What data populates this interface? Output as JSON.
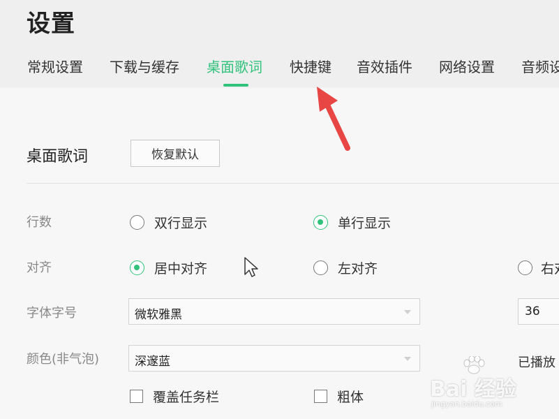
{
  "header": {
    "title": "设置",
    "tabs": [
      {
        "label": "常规设置",
        "active": false
      },
      {
        "label": "下载与缓存",
        "active": false
      },
      {
        "label": "桌面歌词",
        "active": true
      },
      {
        "label": "快捷键",
        "active": false
      },
      {
        "label": "音效插件",
        "active": false
      },
      {
        "label": "网络设置",
        "active": false
      },
      {
        "label": "音频设",
        "active": false
      }
    ]
  },
  "section": {
    "title": "桌面歌词",
    "restore_label": "恢复默认"
  },
  "rows": {
    "lines": {
      "label": "行数",
      "options": [
        {
          "label": "双行显示",
          "checked": false
        },
        {
          "label": "单行显示",
          "checked": true
        }
      ]
    },
    "align": {
      "label": "对齐",
      "options": [
        {
          "label": "居中对齐",
          "checked": true
        },
        {
          "label": "左对齐",
          "checked": false
        },
        {
          "label": "右对",
          "checked": false
        }
      ]
    },
    "font": {
      "label": "字体字号",
      "family": "微软雅黑",
      "size": "36"
    },
    "color": {
      "label": "颜色(非气泡)",
      "value": "深邃蓝",
      "played_label": "已播放"
    }
  },
  "checkboxes": [
    {
      "label": "覆盖任务栏",
      "checked": false
    },
    {
      "label": "粗体",
      "checked": false
    }
  ],
  "watermark": {
    "brand": "Bai 经验",
    "site": "jingyan.baidu.com"
  },
  "colors": {
    "accent": "#31c27c",
    "arrow": "#e84545"
  }
}
